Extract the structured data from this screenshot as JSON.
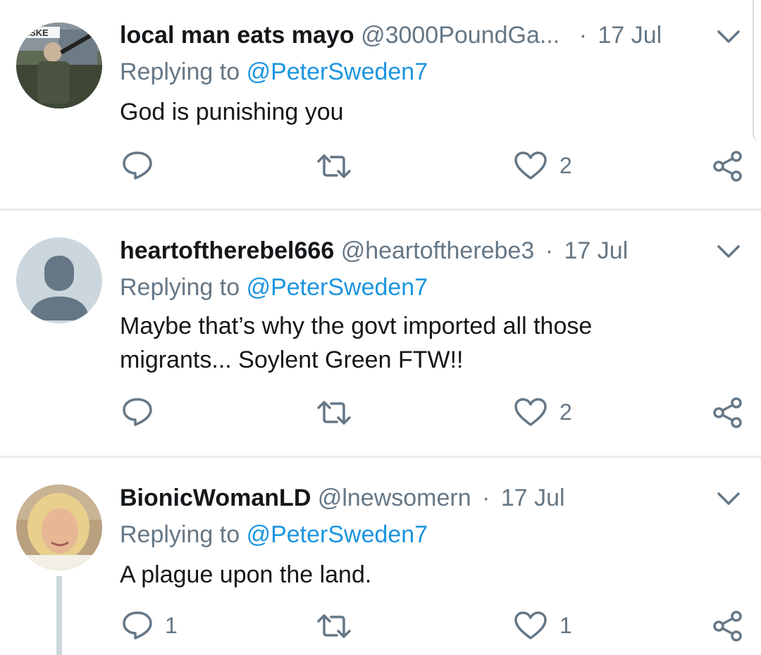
{
  "tweets": [
    {
      "name": "local man eats mayo",
      "handle": "@3000PoundGa...",
      "separator": "·",
      "date": "17 Jul",
      "replying_prefix": "Replying to",
      "replying_to": "@PeterSweden7",
      "text": "God is punishing you",
      "reply_count": "",
      "retweet_count": "",
      "like_count": "2",
      "avatar_badge_text": "AISKE"
    },
    {
      "name": "heartoftherebel666",
      "handle": "@heartoftherebe3",
      "separator": "·",
      "date": "17 Jul",
      "replying_prefix": "Replying to",
      "replying_to": "@PeterSweden7",
      "text": "Maybe that’s why the govt imported all those migrants... Soylent Green FTW!!",
      "reply_count": "",
      "retweet_count": "",
      "like_count": "2"
    },
    {
      "name": "BionicWomanLD",
      "handle": "@lnewsomern",
      "separator": "·",
      "date": "17 Jul",
      "replying_prefix": "Replying to",
      "replying_to": "@PeterSweden7",
      "text": "A plague upon the land.",
      "reply_count": "1",
      "retweet_count": "",
      "like_count": "1"
    }
  ],
  "icons": {
    "reply": "speech-bubble",
    "retweet": "retweet-arrows",
    "like": "heart-outline",
    "share": "share-nodes",
    "more": "chevron-down"
  },
  "colors": {
    "text": "#14171a",
    "secondary": "#657786",
    "link": "#1b95e0",
    "divider": "#e6ecf0"
  }
}
